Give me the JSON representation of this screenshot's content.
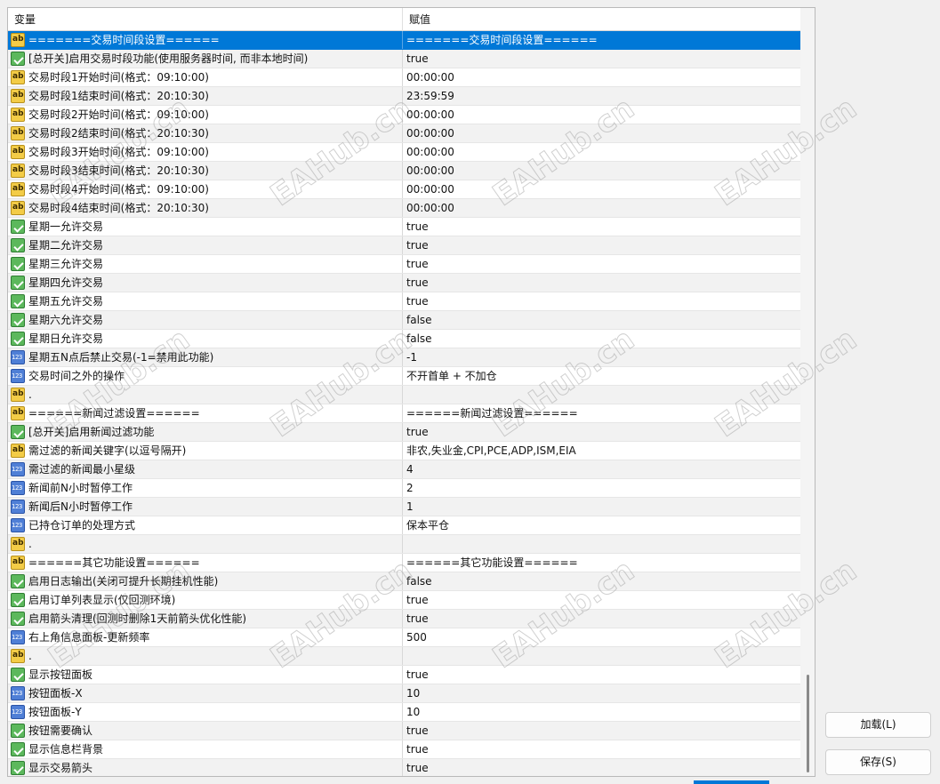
{
  "header": {
    "variable_label": "变量",
    "value_label": "赋值"
  },
  "rows": [
    {
      "type": "ab",
      "name": "=======交易时间段设置======",
      "value": "=======交易时间段设置======"
    },
    {
      "type": "bool",
      "name": "[总开关]启用交易时段功能(使用服务器时间, 而非本地时间)",
      "value": "true"
    },
    {
      "type": "ab",
      "name": "交易时段1开始时间(格式：09:10:00)",
      "value": "00:00:00"
    },
    {
      "type": "ab",
      "name": "交易时段1结束时间(格式：20:10:30)",
      "value": "23:59:59"
    },
    {
      "type": "ab",
      "name": "交易时段2开始时间(格式：09:10:00)",
      "value": "00:00:00"
    },
    {
      "type": "ab",
      "name": "交易时段2结束时间(格式：20:10:30)",
      "value": "00:00:00"
    },
    {
      "type": "ab",
      "name": "交易时段3开始时间(格式：09:10:00)",
      "value": "00:00:00"
    },
    {
      "type": "ab",
      "name": "交易时段3结束时间(格式：20:10:30)",
      "value": "00:00:00"
    },
    {
      "type": "ab",
      "name": "交易时段4开始时间(格式：09:10:00)",
      "value": "00:00:00"
    },
    {
      "type": "ab",
      "name": "交易时段4结束时间(格式：20:10:30)",
      "value": "00:00:00"
    },
    {
      "type": "bool",
      "name": "星期一允许交易",
      "value": "true"
    },
    {
      "type": "bool",
      "name": "星期二允许交易",
      "value": "true"
    },
    {
      "type": "bool",
      "name": "星期三允许交易",
      "value": "true"
    },
    {
      "type": "bool",
      "name": "星期四允许交易",
      "value": "true"
    },
    {
      "type": "bool",
      "name": "星期五允许交易",
      "value": "true"
    },
    {
      "type": "bool",
      "name": "星期六允许交易",
      "value": "false"
    },
    {
      "type": "bool",
      "name": "星期日允许交易",
      "value": "false"
    },
    {
      "type": "num",
      "name": "星期五N点后禁止交易(-1=禁用此功能)",
      "value": "-1"
    },
    {
      "type": "num",
      "name": "交易时间之外的操作",
      "value": "不开首单 + 不加仓"
    },
    {
      "type": "ab",
      "name": ".",
      "value": ""
    },
    {
      "type": "ab",
      "name": "======新闻过滤设置======",
      "value": "======新闻过滤设置======"
    },
    {
      "type": "bool",
      "name": "[总开关]启用新闻过滤功能",
      "value": "true"
    },
    {
      "type": "ab",
      "name": "需过滤的新闻关键字(以逗号隔开)",
      "value": "非农,失业金,CPI,PCE,ADP,ISM,EIA"
    },
    {
      "type": "num",
      "name": "需过滤的新闻最小星级",
      "value": "4"
    },
    {
      "type": "num",
      "name": "新闻前N小时暂停工作",
      "value": "2"
    },
    {
      "type": "num",
      "name": "新闻后N小时暂停工作",
      "value": "1"
    },
    {
      "type": "num",
      "name": "已持仓订单的处理方式",
      "value": "保本平仓"
    },
    {
      "type": "ab",
      "name": ".",
      "value": ""
    },
    {
      "type": "ab",
      "name": "======其它功能设置======",
      "value": "======其它功能设置======"
    },
    {
      "type": "bool",
      "name": "启用日志输出(关闭可提升长期挂机性能)",
      "value": "false"
    },
    {
      "type": "bool",
      "name": "启用订单列表显示(仅回测环境)",
      "value": "true"
    },
    {
      "type": "bool",
      "name": "启用箭头清理(回测时删除1天前箭头优化性能)",
      "value": "true"
    },
    {
      "type": "num",
      "name": "右上角信息面板-更新频率",
      "value": "500"
    },
    {
      "type": "ab",
      "name": ".",
      "value": ""
    },
    {
      "type": "bool",
      "name": "显示按钮面板",
      "value": "true"
    },
    {
      "type": "num",
      "name": "按钮面板-X",
      "value": "10"
    },
    {
      "type": "num",
      "name": "按钮面板-Y",
      "value": "10"
    },
    {
      "type": "bool",
      "name": "按钮需要确认",
      "value": "true"
    },
    {
      "type": "bool",
      "name": "显示信息栏背景",
      "value": "true"
    },
    {
      "type": "bool",
      "name": "显示交易箭头",
      "value": "true"
    }
  ],
  "selected_row": 0,
  "buttons": {
    "load_label": "加载(L)",
    "save_label": "保存(S)"
  },
  "watermark": "EAHub.cn",
  "colors": {
    "selection": "#0078d7",
    "alt_row": "#f2f2f2"
  }
}
